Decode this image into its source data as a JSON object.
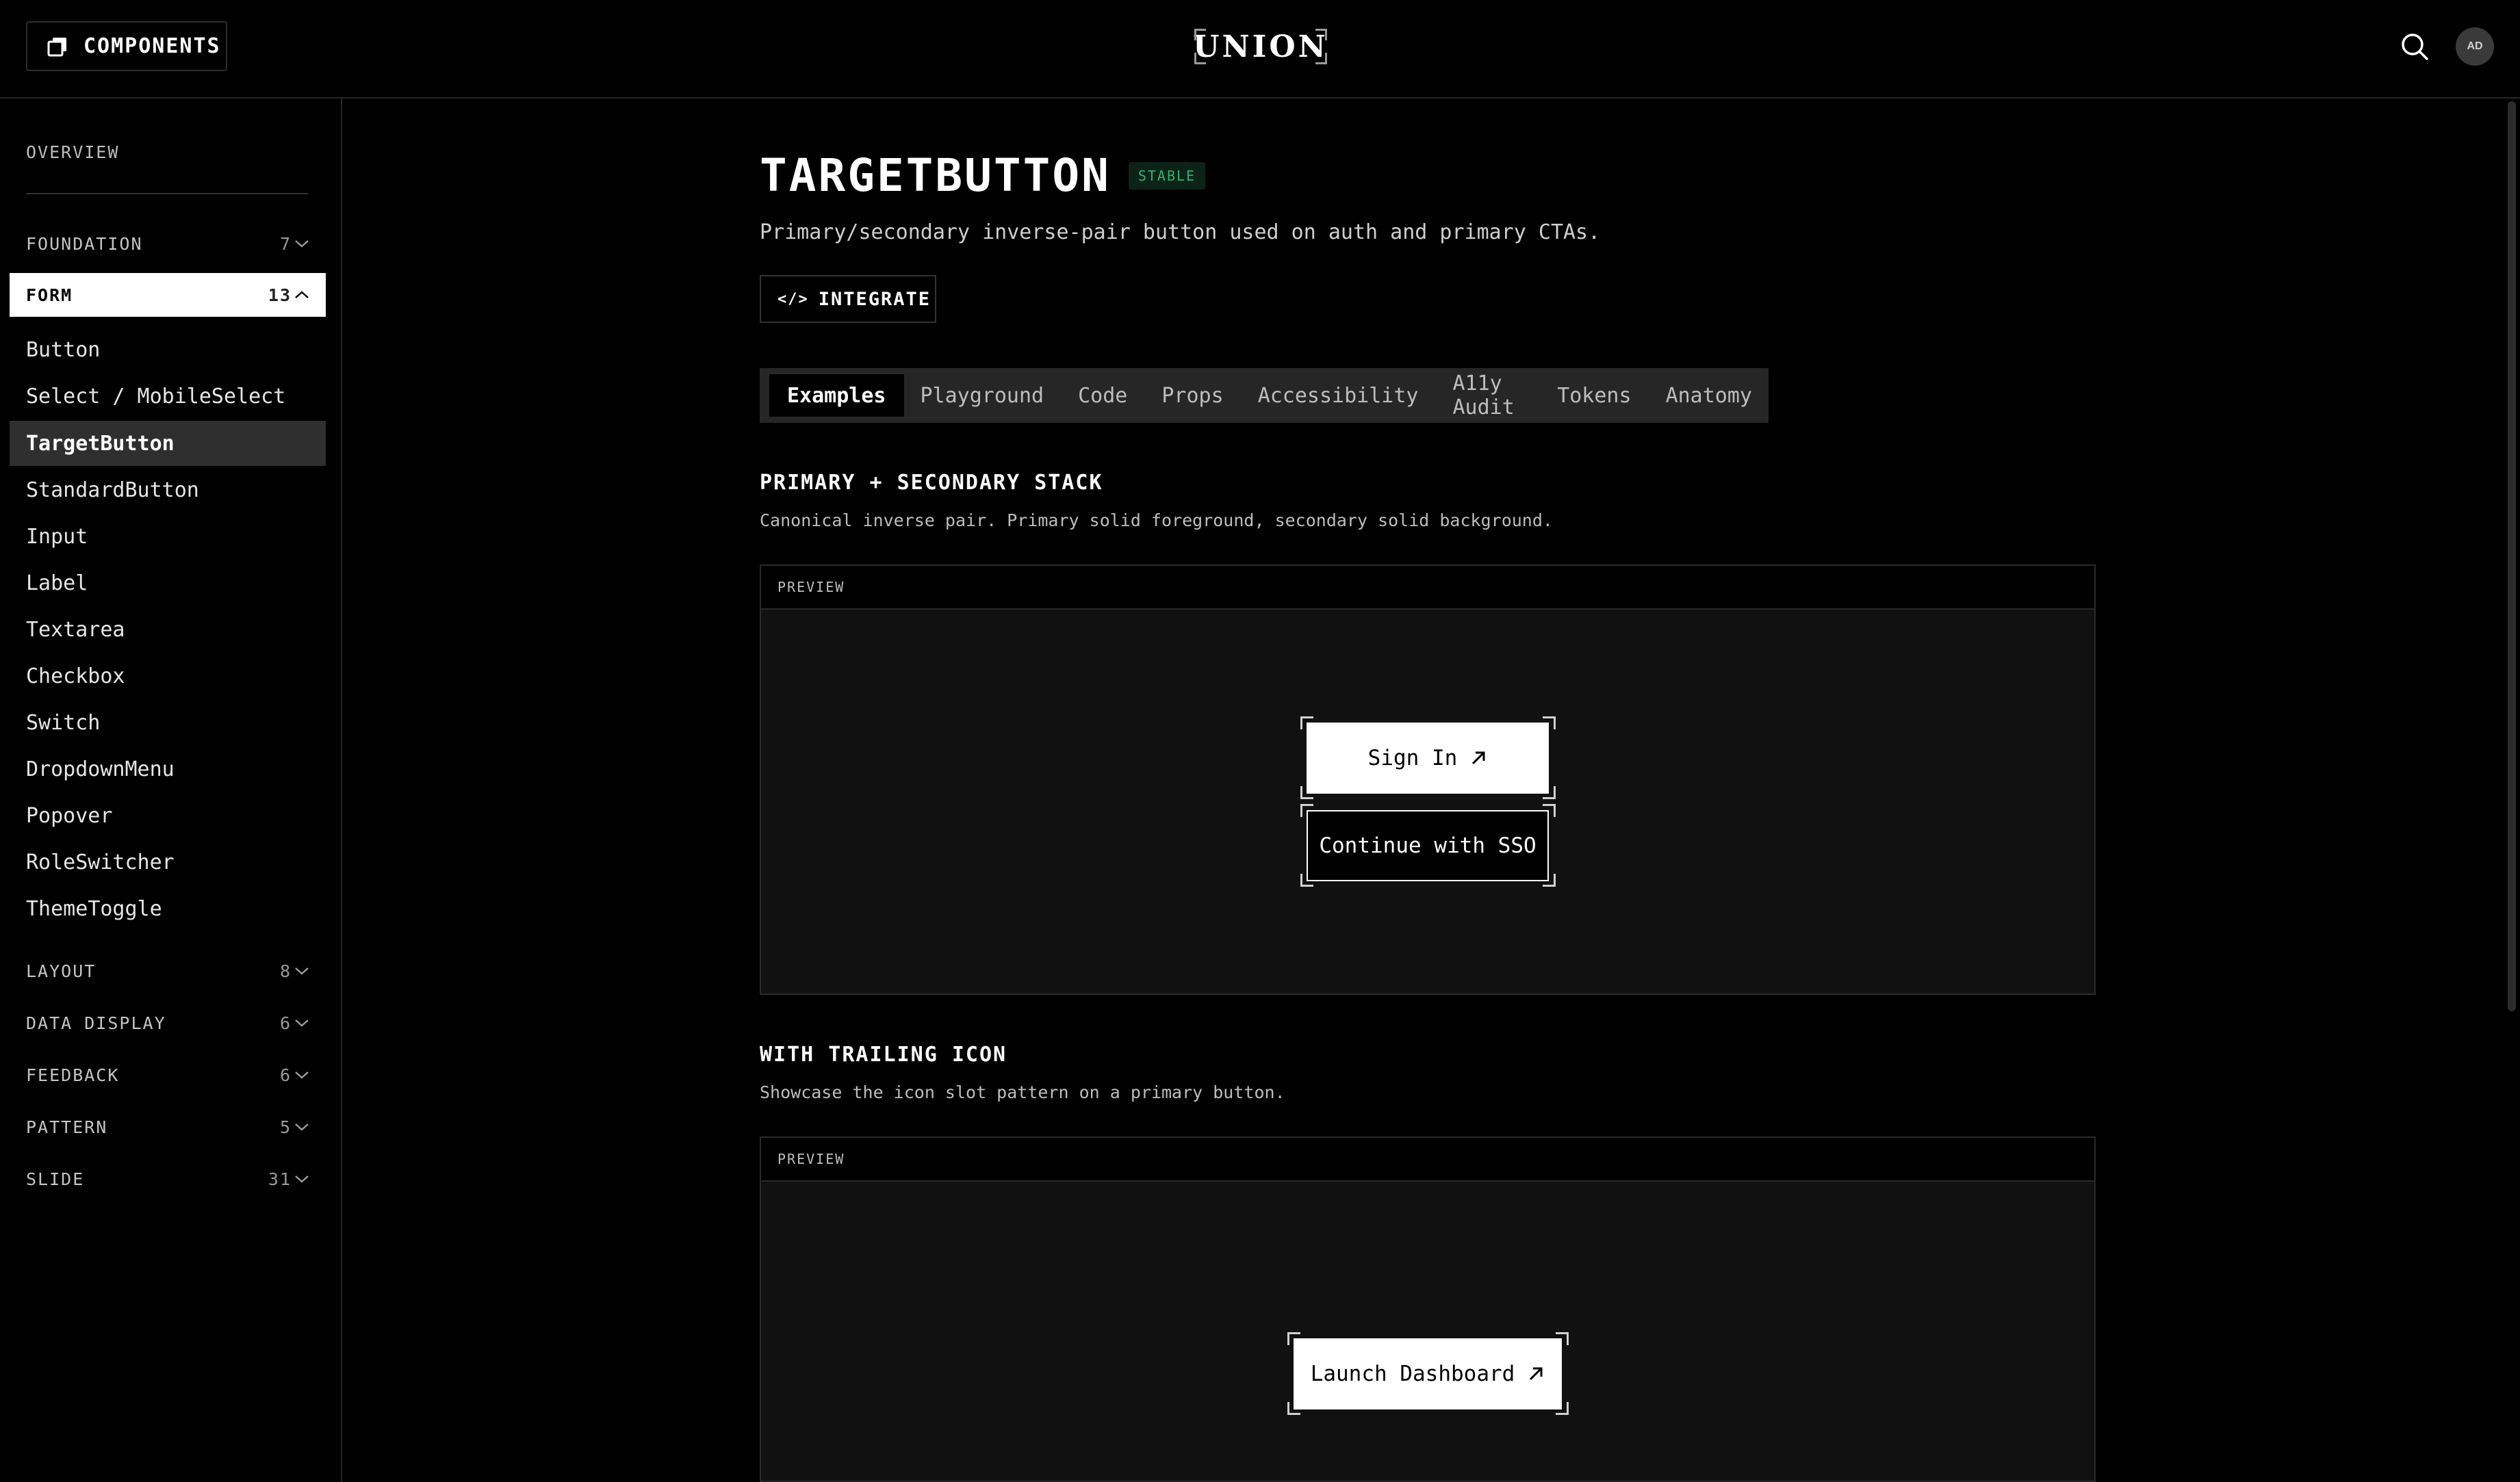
{
  "header": {
    "components_label": "COMPONENTS",
    "logo": "UNION",
    "avatar_initials": "AD"
  },
  "sidebar": {
    "overview": "OVERVIEW",
    "categories": {
      "foundation": {
        "label": "FOUNDATION",
        "count": "7"
      },
      "form": {
        "label": "FORM",
        "count": "13"
      },
      "layout": {
        "label": "LAYOUT",
        "count": "8"
      },
      "data_display": {
        "label": "DATA DISPLAY",
        "count": "6"
      },
      "feedback": {
        "label": "FEEDBACK",
        "count": "6"
      },
      "pattern": {
        "label": "PATTERN",
        "count": "5"
      },
      "slide": {
        "label": "SLIDE",
        "count": "31"
      }
    },
    "form_items": [
      "Button",
      "Select / MobileSelect",
      "TargetButton",
      "StandardButton",
      "Input",
      "Label",
      "Textarea",
      "Checkbox",
      "Switch",
      "DropdownMenu",
      "Popover",
      "RoleSwitcher",
      "ThemeToggle"
    ],
    "selected_item": "TargetButton"
  },
  "main": {
    "title": "TARGETBUTTON",
    "badge": "STABLE",
    "description": "Primary/secondary inverse-pair button used on auth and primary CTAs.",
    "integrate_label": "INTEGRATE",
    "tabs": [
      "Examples",
      "Playground",
      "Code",
      "Props",
      "Accessibility",
      "A11y Audit",
      "Tokens",
      "Anatomy"
    ],
    "active_tab": "Examples",
    "sections": [
      {
        "title": "PRIMARY + SECONDARY STACK",
        "description": "Canonical inverse pair. Primary solid foreground, secondary solid background.",
        "preview_label": "PREVIEW",
        "primary_label": "Sign In",
        "secondary_label": "Continue with SSO"
      },
      {
        "title": "WITH TRAILING ICON",
        "description": "Showcase the icon slot pattern on a primary button.",
        "preview_label": "PREVIEW",
        "primary_label": "Launch Dashboard"
      }
    ]
  },
  "colors": {
    "background": "#000000",
    "surface": "#111111",
    "badge_text": "#2fb36a",
    "badge_bg": "#0c2418"
  }
}
